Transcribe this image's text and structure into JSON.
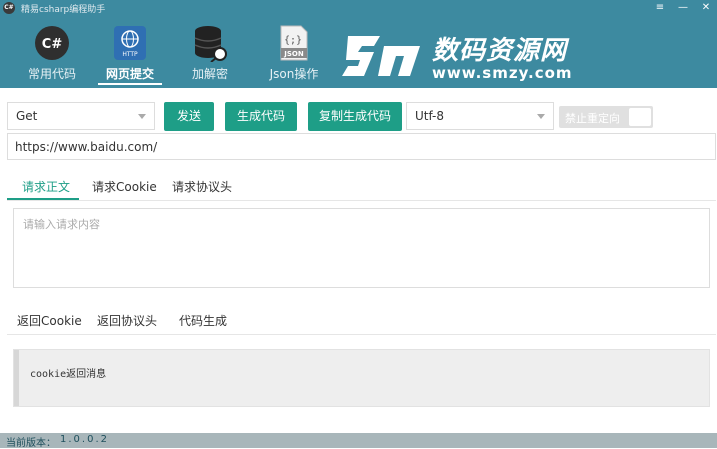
{
  "window": {
    "title": "精易csharp编程助手",
    "app_icon_text": "C#",
    "menu_glyph": "≡",
    "minimize_glyph": "—",
    "close_glyph": "✕"
  },
  "nav": {
    "items": [
      {
        "label": "常用代码",
        "icon": "csharp-icon",
        "icon_text": "C#",
        "active": false
      },
      {
        "label": "网页提交",
        "icon": "http-globe-icon",
        "icon_text": "HTTP",
        "active": true
      },
      {
        "label": "加解密",
        "icon": "database-key-icon",
        "active": false
      },
      {
        "label": "Json操作",
        "icon": "json-file-icon",
        "icon_text": "JSON",
        "icon_braces": "{;}",
        "active": false
      }
    ]
  },
  "brand": {
    "logo_text": "数码资源网",
    "url": "www.smzy.com"
  },
  "toolbar": {
    "method_select": "Get",
    "send_label": "发送",
    "generate_label": "生成代码",
    "copy_generate_label": "复制生成代码",
    "encoding_select": "Utf-8",
    "redirect_toggle_label": "禁止重定向"
  },
  "url_input": {
    "value": "https://www.baidu.com/"
  },
  "request_tabs": [
    {
      "label": "请求正文",
      "active": true
    },
    {
      "label": "请求Cookie",
      "active": false
    },
    {
      "label": "请求协议头",
      "active": false
    }
  ],
  "request_body": {
    "placeholder": "请输入请求内容"
  },
  "response_tabs": [
    {
      "label": "返回Cookie"
    },
    {
      "label": "返回协议头"
    },
    {
      "label": "代码生成"
    }
  ],
  "response": {
    "text": "cookie返回消息"
  },
  "status": {
    "label": "当前版本：",
    "version": "1.0.0.2"
  },
  "colors": {
    "header": "#3d8aa0",
    "accent": "#1e9e87",
    "status_bar": "#a8b6ba"
  }
}
